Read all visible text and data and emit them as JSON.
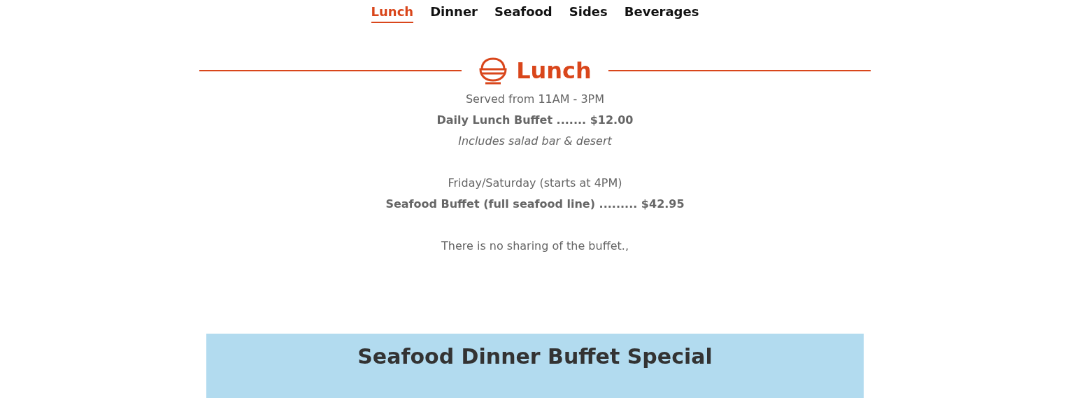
{
  "tabs": [
    {
      "label": "Lunch",
      "selected": true
    },
    {
      "label": "Dinner",
      "selected": false
    },
    {
      "label": "Seafood",
      "selected": false
    },
    {
      "label": "Sides",
      "selected": false
    },
    {
      "label": "Beverages",
      "selected": false
    }
  ],
  "section": {
    "title": "Lunch",
    "paragraphs": [
      [
        {
          "kind": "plain",
          "text": "Served from 11AM - 3PM"
        },
        {
          "kind": "bold",
          "text": "Daily Lunch Buffet ....... $12.00"
        },
        {
          "kind": "italic",
          "text": "Includes salad bar & desert"
        }
      ],
      [
        {
          "kind": "plain",
          "text": "Friday/Saturday (starts at 4PM)"
        },
        {
          "kind": "bold",
          "text": "Seafood Buffet (full seafood line) ......... $42.95"
        }
      ],
      [
        {
          "kind": "plain",
          "text": "There is no sharing of the buffet.,"
        }
      ]
    ]
  },
  "banner": {
    "title": "Seafood Dinner Buffet Special"
  }
}
